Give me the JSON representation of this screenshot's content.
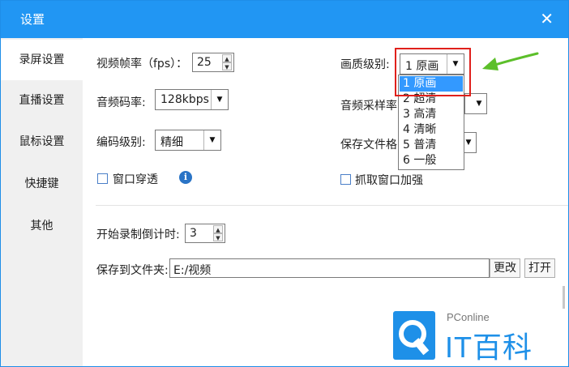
{
  "window": {
    "title": "设置"
  },
  "sidebar": {
    "items": [
      {
        "label": "录屏设置",
        "active": true
      },
      {
        "label": "直播设置",
        "active": false
      },
      {
        "label": "鼠标设置",
        "active": false
      },
      {
        "label": "快捷键",
        "active": false
      },
      {
        "label": "其他",
        "active": false
      }
    ]
  },
  "settings": {
    "fps_label": "视频帧率（fps）：",
    "fps_value": "25",
    "bitrate_label": "音频码率:",
    "bitrate_value": "128kbps",
    "encode_label": "编码级别:",
    "encode_value": "精细",
    "window_through_label": "窗口穿透",
    "window_through_checked": false,
    "quality_label": "画质级别:",
    "quality_value": "1 原画",
    "samplerate_label": "音频采样率",
    "saveformat_label": "保存文件格",
    "capture_enhance_label": "抓取窗口加强",
    "capture_enhance_checked": false,
    "countdown_label": "开始录制倒计时:",
    "countdown_value": "3",
    "savepath_label": "保存到文件夹:",
    "savepath_value": "E:/视频",
    "change_btn": "更改",
    "open_btn": "打开"
  },
  "quality_options": [
    "1 原画",
    "2 超清",
    "3 高清",
    "4 清晰",
    "5 普清",
    "6 一般"
  ],
  "quality_selected_index": 0,
  "watermark": {
    "top": "PConline",
    "brand": "IT百科"
  },
  "colors": {
    "titlebar": "#2196f3",
    "highlight": "#3399ff",
    "annotation_box": "#e0201b",
    "annotation_arrow": "#5cbf2a"
  }
}
